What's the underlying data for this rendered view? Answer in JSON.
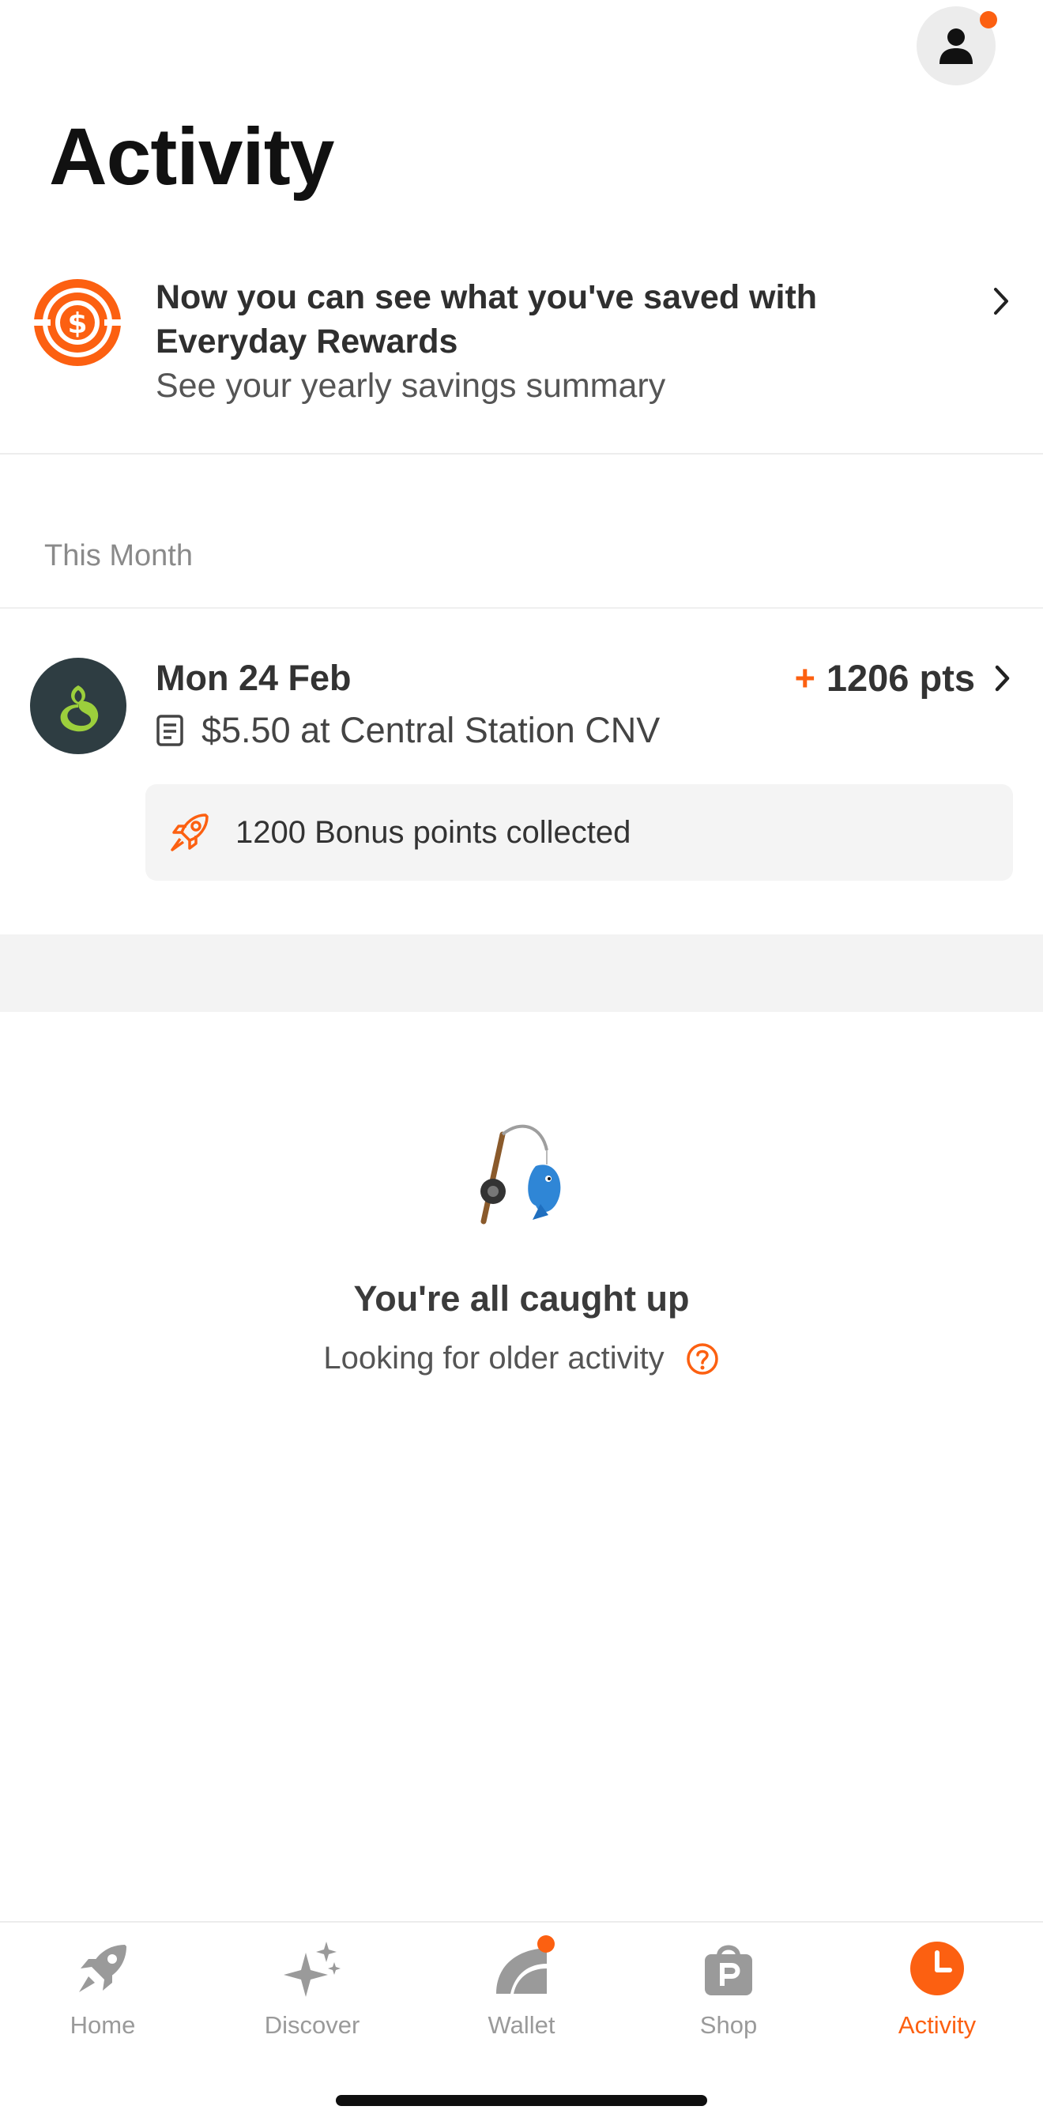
{
  "header": {
    "title": "Activity",
    "profile_icon": "person-icon",
    "notification_color": "#fc6011"
  },
  "promo": {
    "icon": "dollar-coin-icon",
    "title": "Now you can see what you've saved with Everyday Rewards",
    "subtitle": "See your yearly savings summary"
  },
  "section": {
    "label": "This Month"
  },
  "transaction": {
    "date": "Mon 24 Feb",
    "plus": "+",
    "points": "1206 pts",
    "amount_text": "$5.50 at Central Station CNV",
    "store_logo": "woolworths-logo",
    "bonus_text": "1200 Bonus points collected"
  },
  "empty_state": {
    "icon": "fishing-rod-icon",
    "title": "You're all caught up",
    "older_text": "Looking for older activity"
  },
  "tabs": [
    {
      "label": "Home",
      "icon": "rocket-icon",
      "active": false
    },
    {
      "label": "Discover",
      "icon": "sparkles-icon",
      "active": false
    },
    {
      "label": "Wallet",
      "icon": "wallet-icon",
      "active": false,
      "has_badge": true
    },
    {
      "label": "Shop",
      "icon": "shopping-bag-icon",
      "active": false
    },
    {
      "label": "Activity",
      "icon": "clock-icon",
      "active": true
    }
  ],
  "colors": {
    "accent": "#fc6011",
    "inactive_tab": "#9a9a9a",
    "store_logo_bg": "#2e3d42"
  }
}
